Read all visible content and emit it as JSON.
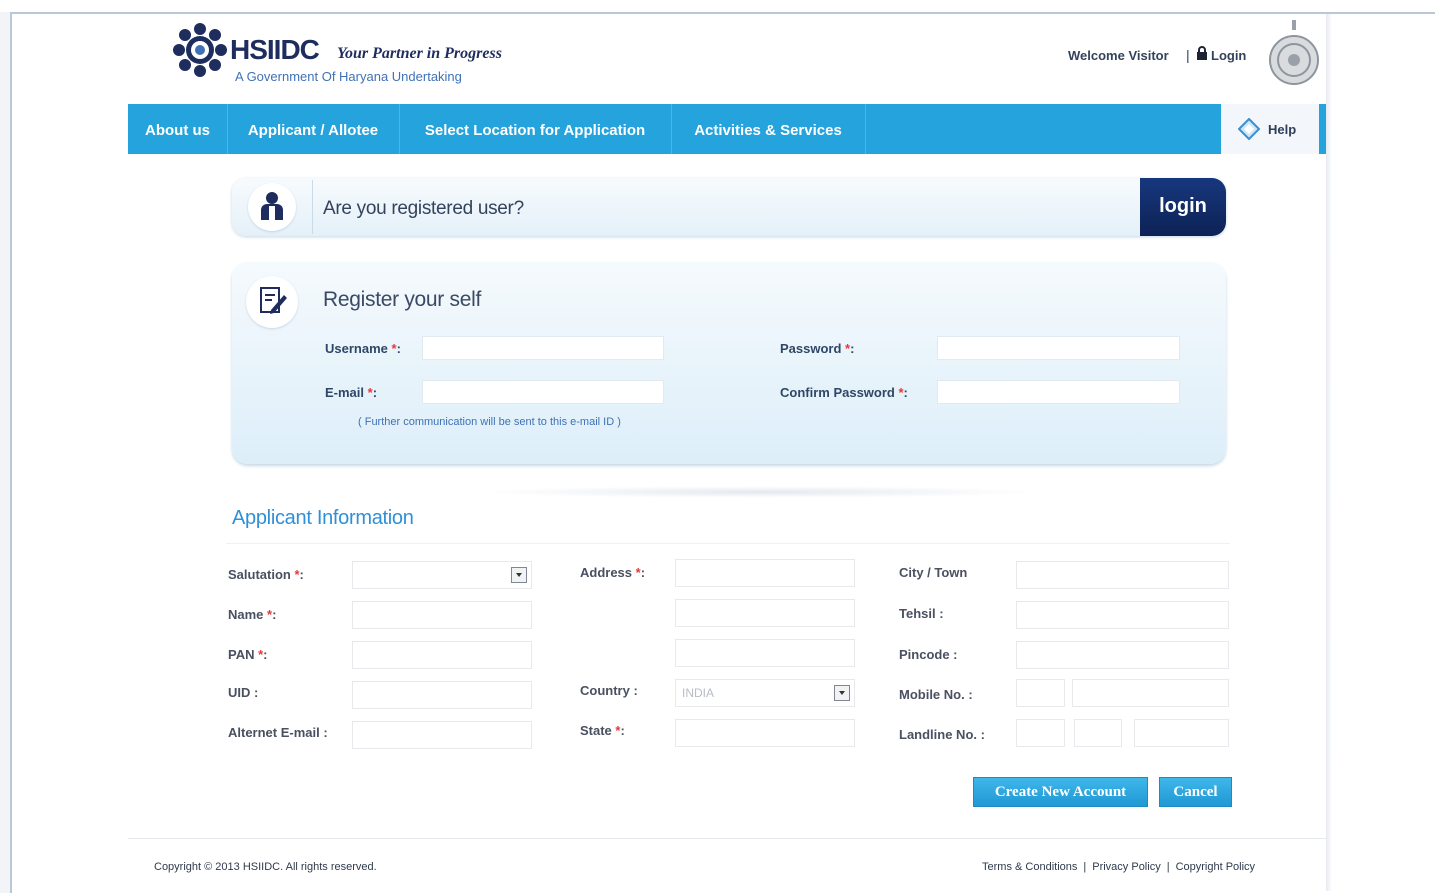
{
  "header": {
    "brand": "HSIIDC",
    "tagline": "Your Partner in Progress",
    "subtag": "A Government Of Haryana Undertaking",
    "welcome": "Welcome Visitor",
    "separator": "|",
    "login_link": "Login"
  },
  "nav": {
    "items": [
      {
        "label": "About us"
      },
      {
        "label": "Applicant / Allotee"
      },
      {
        "label": "Select Location for Application"
      },
      {
        "label": "Activities & Services"
      }
    ],
    "help": "Help"
  },
  "login_bar": {
    "question": "Are you registered user?",
    "button": "login"
  },
  "register": {
    "title": "Register your self",
    "username_label": "Username",
    "password_label": "Password",
    "email_label": "E-mail",
    "confirm_password_label": "Confirm Password",
    "required_mark": "*",
    "label_suffix": ":",
    "email_note": "( Further communication will be sent to this e-mail ID )"
  },
  "applicant": {
    "title": "Applicant Information",
    "salutation_label": "Salutation",
    "name_label": "Name",
    "pan_label": "PAN",
    "uid_label": "UID :",
    "alternate_email_label": "Alternet E-mail :",
    "address_label": "Address",
    "country_label": "Country :",
    "country_value": "INDIA",
    "state_label": "State",
    "city_label": "City / Town",
    "tehsil_label": "Tehsil :",
    "pincode_label": "Pincode :",
    "mobile_label": "Mobile No. :",
    "landline_label": "Landline No. :"
  },
  "actions": {
    "create": "Create New Account",
    "cancel": "Cancel"
  },
  "footer": {
    "copyright": "Copyright © 2013 HSIIDC. All rights reserved.",
    "links": [
      "Terms & Conditions",
      "Privacy Policy",
      "Copyright Policy"
    ],
    "pipe": "|"
  },
  "colors": {
    "nav": "#24a3dc",
    "login_button": "#13307a",
    "brand": "#1e2d5e",
    "accent_title": "#2f8fd8",
    "required": "#e3383d"
  }
}
